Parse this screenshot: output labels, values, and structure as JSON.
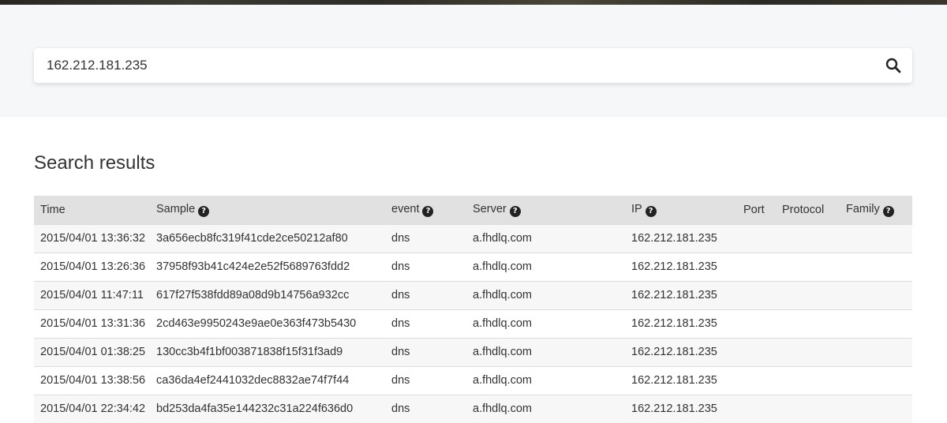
{
  "search": {
    "value": "162.212.181.235",
    "icon": "search-icon"
  },
  "results": {
    "title": "Search results",
    "columns": {
      "time": "Time",
      "sample": "Sample",
      "event": "event",
      "server": "Server",
      "ip": "IP",
      "port": "Port",
      "protocol": "Protocol",
      "family": "Family"
    },
    "help_icon": "?",
    "rows": [
      {
        "time": "2015/04/01 13:36:32",
        "sample": "3a656ecb8fc319f41cde2ce50212af80",
        "event": "dns",
        "server": "a.fhdlq.com",
        "ip": "162.212.181.235",
        "port": "",
        "protocol": "",
        "family": ""
      },
      {
        "time": "2015/04/01 13:26:36",
        "sample": "37958f93b41c424e2e52f5689763fdd2",
        "event": "dns",
        "server": "a.fhdlq.com",
        "ip": "162.212.181.235",
        "port": "",
        "protocol": "",
        "family": ""
      },
      {
        "time": "2015/04/01 11:47:11",
        "sample": "617f27f538fdd89a08d9b14756a932cc",
        "event": "dns",
        "server": "a.fhdlq.com",
        "ip": "162.212.181.235",
        "port": "",
        "protocol": "",
        "family": ""
      },
      {
        "time": "2015/04/01 13:31:36",
        "sample": "2cd463e9950243e9ae0e363f473b5430",
        "event": "dns",
        "server": "a.fhdlq.com",
        "ip": "162.212.181.235",
        "port": "",
        "protocol": "",
        "family": ""
      },
      {
        "time": "2015/04/01 01:38:25",
        "sample": "130cc3b4f1bf003871838f15f31f3ad9",
        "event": "dns",
        "server": "a.fhdlq.com",
        "ip": "162.212.181.235",
        "port": "",
        "protocol": "",
        "family": ""
      },
      {
        "time": "2015/04/01 13:38:56",
        "sample": "ca36da4ef2441032dec8832ae74f7f44",
        "event": "dns",
        "server": "a.fhdlq.com",
        "ip": "162.212.181.235",
        "port": "",
        "protocol": "",
        "family": ""
      },
      {
        "time": "2015/04/01 22:34:42",
        "sample": "bd253da4fa35e144232c31a224f636d0",
        "event": "dns",
        "server": "a.fhdlq.com",
        "ip": "162.212.181.235",
        "port": "",
        "protocol": "",
        "family": ""
      }
    ]
  }
}
